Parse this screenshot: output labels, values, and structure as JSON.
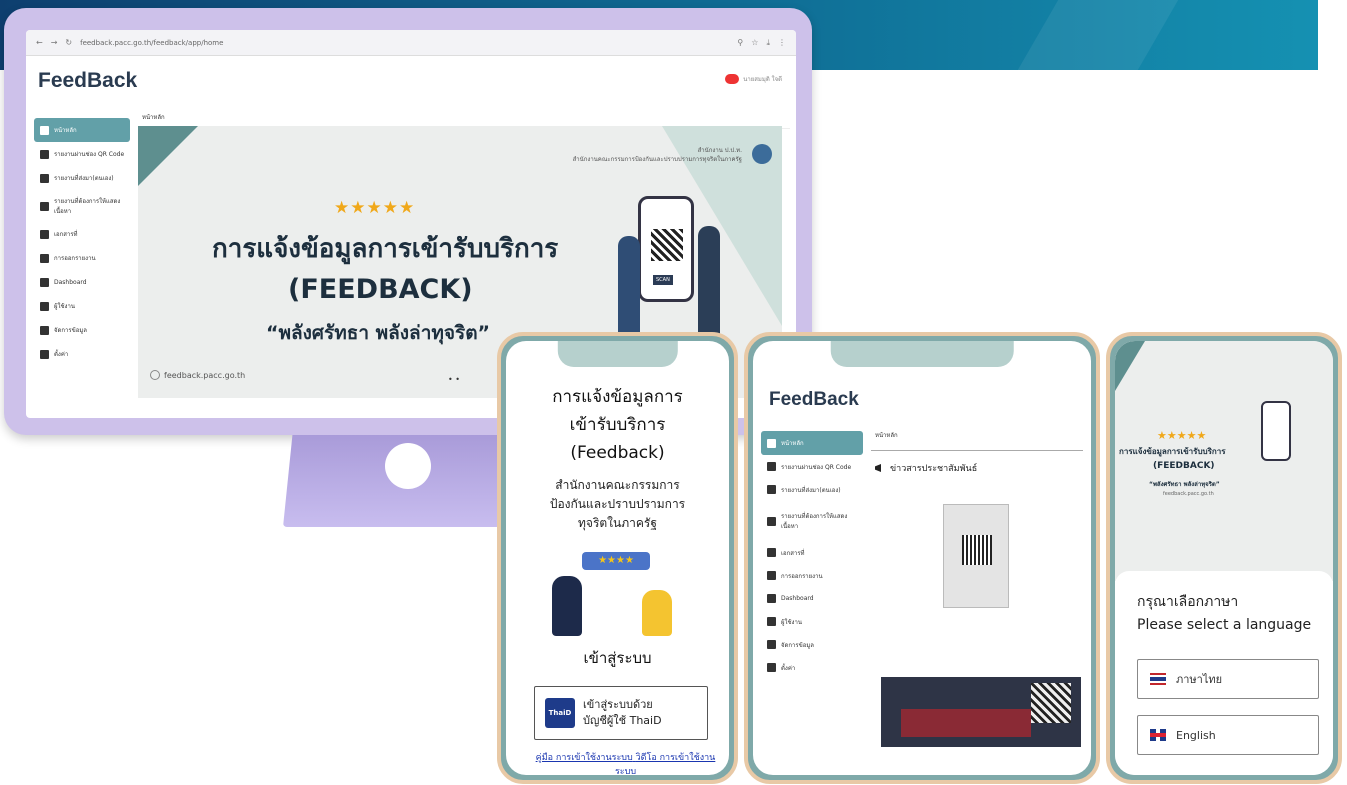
{
  "browser": {
    "url": "feedback.pacc.go.th/feedback/app/home"
  },
  "app": {
    "logo": "FeedBack",
    "user": "นายสมมุติ ใจดี"
  },
  "sidebar": {
    "items": [
      {
        "label": "หน้าหลัก"
      },
      {
        "label": "รายงานผ่านช่อง QR Code"
      },
      {
        "label": "รายงานที่ส่งมา(ตนเอง)"
      },
      {
        "label": "รายงานที่ต้องการให้แสดงเนื้อหา"
      },
      {
        "label": "เอกสารที่"
      },
      {
        "label": "การออกรายงาน"
      },
      {
        "label": "Dashboard"
      },
      {
        "label": "ผู้ใช้งาน"
      },
      {
        "label": "จัดการข้อมูล"
      },
      {
        "label": "ตั้งค่า"
      }
    ]
  },
  "breadcrumb": "หน้าหลัก",
  "hero": {
    "stars": "★★★★★",
    "title": "การแจ้งข้อมูลการเข้ารับบริการ",
    "subtitle": "(FEEDBACK)",
    "slogan": "“พลังศรัทธา พลังล่าทุจริต”",
    "org_line1": "สำนักงาน ป.ป.ท.",
    "org_line2": "สำนักงานคณะกรรมการป้องกันและปราบปรามการทุจริตในภาครัฐ",
    "site": "feedback.pacc.go.th",
    "pager": "• •",
    "scan": "SCAN"
  },
  "phone1": {
    "title_l1": "การแจ้งข้อมูลการ",
    "title_l2": "เข้ารับบริการ",
    "title_l3": "(Feedback)",
    "org_l1": "สำนักงานคณะกรรมการ",
    "org_l2": "ป้องกันและปราบปรามการ",
    "org_l3": "ทุจริตในภาครัฐ",
    "rating": "★★★★",
    "login": "เข้าสู่ระบบ",
    "thaid_logo": "ThaiD",
    "thaid_l1": "เข้าสู่ระบบด้วย",
    "thaid_l2": "บัญชีผู้ใช้ ThaiD",
    "link_manual": "คู่มือ การเข้าใช้งานระบบ",
    "link_video": "วิดีโอ การเข้าใช้งานระบบ"
  },
  "phone2": {
    "logo": "FeedBack",
    "breadcrumb": "หน้าหลัก",
    "news": "ข่าวสารประชาสัมพันธ์"
  },
  "phone3": {
    "stars": "★★★★★",
    "t1": "การแจ้งข้อมูลการเข้ารับบริการ",
    "t2": "(FEEDBACK)",
    "t3": "“พลังศรัทธา พลังล่าทุจริต”",
    "site": "feedback.pacc.go.th",
    "heading_th": "กรุณาเลือกภาษา",
    "heading_en": "Please select a language",
    "lang_th": "ภาษาไทย",
    "lang_en": "English"
  },
  "colors": {
    "accent": "#62a0a8",
    "banner": "#0f6b93",
    "frame": "#cdc1ea",
    "phone_border": "#e8c9a6"
  }
}
